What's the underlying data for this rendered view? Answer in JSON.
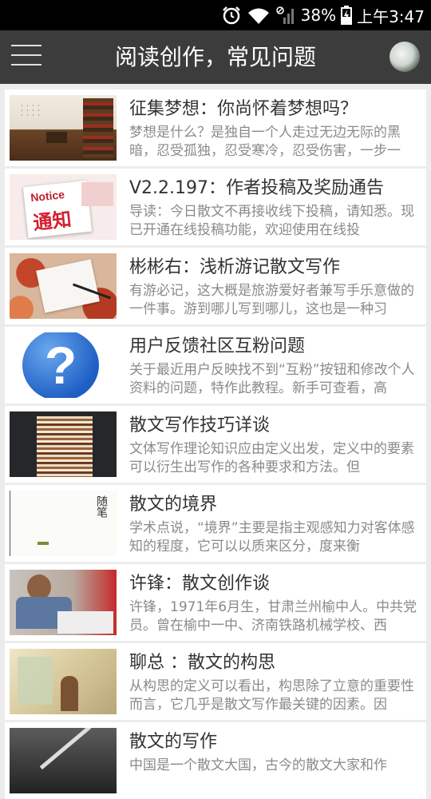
{
  "status": {
    "battery": "38%",
    "time": "上午3:47"
  },
  "header": {
    "title": "阅读创作，常见问题"
  },
  "articles": [
    {
      "title": "征集梦想：你尚怀着梦想吗？",
      "desc": "梦想是什么？是独自一个人走过无边无际的黑暗，忍受孤独，忍受寒冷，忍受伤害，一步一"
    },
    {
      "title": "V2.2.197：作者投稿及奖励通告",
      "desc": "导读：今日散文不再接收线下投稿，请知悉。现已开通在线投稿功能，欢迎使用在线投"
    },
    {
      "title": "彬彬右：浅析游记散文写作",
      "desc": "有游必记，这大概是旅游爱好者兼写手乐意做的一件事。游到哪儿写到哪儿，这也是一种习"
    },
    {
      "title": "用户反馈社区互粉问题",
      "desc": "关于最近用户反映找不到“互粉”按钮和修改个人资料的问题，特作此教程。新手可查看，高"
    },
    {
      "title": "散文写作技巧详谈",
      "desc": "文体写作理论知识应由定义出发，定义中的要素可以衍生出写作的各种要求和方法。但"
    },
    {
      "title": "散文的境界",
      "desc": "学术点说，“境界”主要是指主观感知力对客体感知的程度，它可以以质来区分，度来衡"
    },
    {
      "title": "许锋：散文创作谈",
      "desc": "许锋，1971年6月生，甘肃兰州榆中人。中共党员。曾在榆中一中、济南铁路机械学校、西"
    },
    {
      "title": "聊总 ：散文的构思",
      "desc": "从构思的定义可以看出，构思除了立意的重要性而言，它几乎是散文写作最关键的因素。因"
    },
    {
      "title": "散文的写作",
      "desc": "中国是一个散文大国，古今的散文大家和作"
    }
  ],
  "thumb_text": {
    "notice_en": "Notice",
    "notice_cn": "通知",
    "book_char": "随笔"
  }
}
